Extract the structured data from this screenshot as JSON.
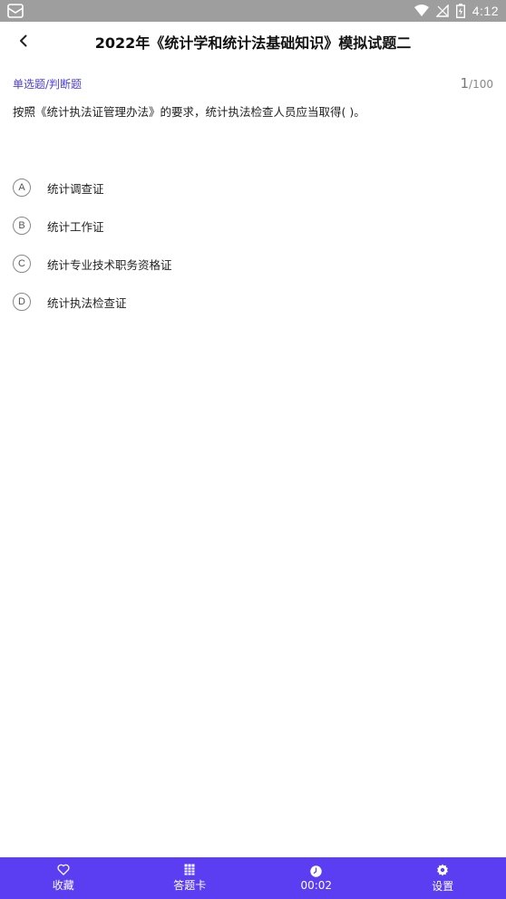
{
  "status_bar": {
    "time": "4:12",
    "icons": [
      "notification-icon",
      "wifi-icon",
      "signal-icon",
      "battery-icon"
    ]
  },
  "header": {
    "title": "2022年《统计学和统计法基础知识》模拟试题二"
  },
  "question": {
    "type_label": "单选题/判断题",
    "current": "1",
    "separator": "/",
    "total": "100",
    "text": "按照《统计执法证管理办法》的要求，统计执法检查人员应当取得(   )。",
    "options": [
      {
        "letter": "A",
        "text": "统计调查证"
      },
      {
        "letter": "B",
        "text": "统计工作证"
      },
      {
        "letter": "C",
        "text": "统计专业技术职务资格证"
      },
      {
        "letter": "D",
        "text": "统计执法检查证"
      }
    ]
  },
  "bottom_bar": {
    "favorite_label": "收藏",
    "answer_card_label": "答题卡",
    "timer": "00:02",
    "settings_label": "设置"
  },
  "colors": {
    "accent": "#5b3df2",
    "type_label": "#4a3de8",
    "status_bar": "#9e9e9e"
  }
}
